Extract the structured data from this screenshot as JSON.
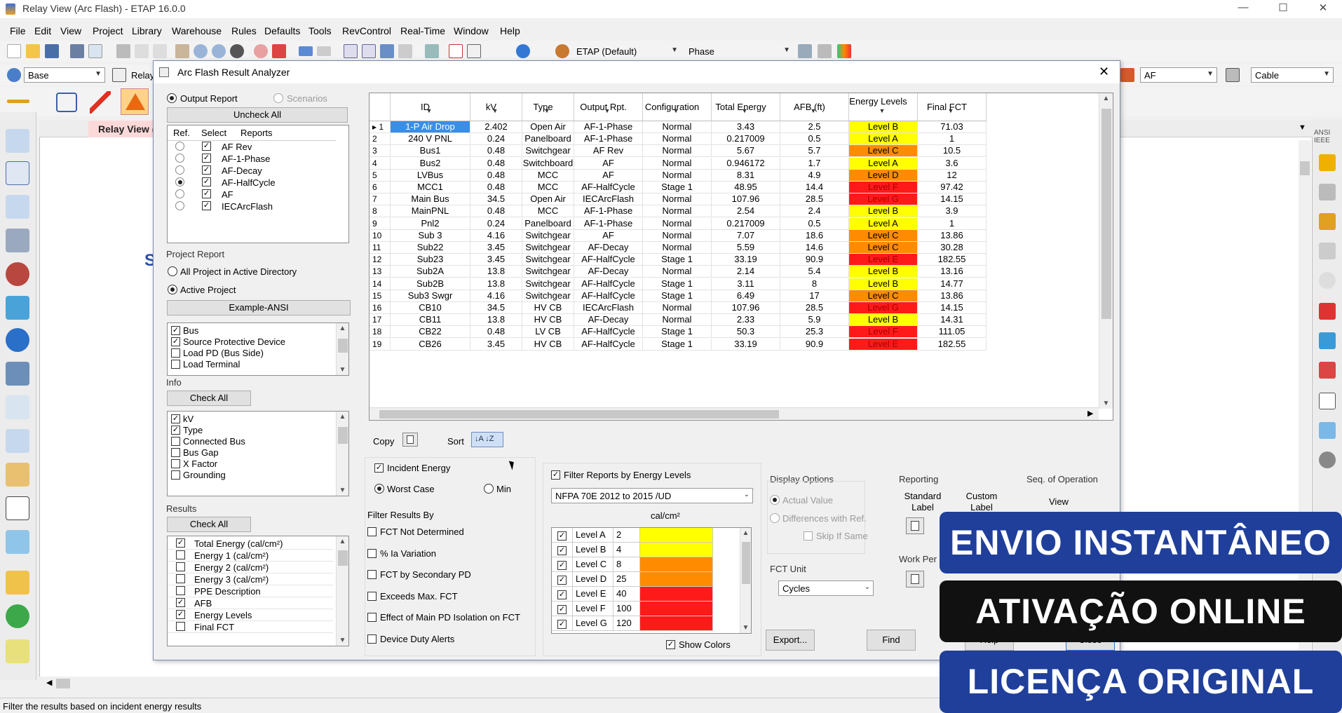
{
  "window": {
    "title": "Relay View (Arc Flash) - ETAP 16.0.0",
    "minimize": "—",
    "maximize": "☐",
    "close": "✕"
  },
  "menu": [
    "File",
    "Edit",
    "View",
    "Project",
    "Library",
    "Warehouse",
    "Rules",
    "Defaults",
    "Tools",
    "RevControl",
    "Real-Time",
    "Window",
    "Help"
  ],
  "toolbar": {
    "preset_select": "ETAP (Default)",
    "phase_select": "Phase",
    "base_select": "Base",
    "relay_label": "Relay",
    "af_select": "AF",
    "cable_select": "Cable"
  },
  "view_tab": "Relay View (Arc Fl",
  "canvas_text": "S",
  "dialog": {
    "title": "Arc Flash Result Analyzer",
    "close": "✕",
    "reports": {
      "output_report": "Output Report",
      "scenarios": "Scenarios",
      "uncheck_all": "Uncheck All",
      "headers": [
        "Ref.",
        "Select",
        "Reports"
      ],
      "rows": [
        {
          "name": "AF Rev",
          "ref": false,
          "selected": true
        },
        {
          "name": "AF-1-Phase",
          "ref": false,
          "selected": true
        },
        {
          "name": "AF-Decay",
          "ref": false,
          "selected": true
        },
        {
          "name": "AF-HalfCycle",
          "ref": true,
          "selected": true
        },
        {
          "name": "AF",
          "ref": false,
          "selected": true
        },
        {
          "name": "IECArcFlash",
          "ref": false,
          "selected": true
        }
      ]
    },
    "project_report": {
      "label": "Project Report",
      "all_project": "All Project in Active Directory",
      "active_project": "Active Project",
      "project_name": "Example-ANSI"
    },
    "device_list": [
      {
        "label": "Bus",
        "checked": true
      },
      {
        "label": "Source Protective Device",
        "checked": true
      },
      {
        "label": "Load PD (Bus Side)",
        "checked": false
      },
      {
        "label": "Load Terminal",
        "checked": false
      }
    ],
    "info": {
      "label": "Info",
      "check_all": "Check All",
      "items": [
        {
          "label": "kV",
          "checked": true
        },
        {
          "label": "Type",
          "checked": true
        },
        {
          "label": "Connected Bus",
          "checked": false
        },
        {
          "label": "Bus Gap",
          "checked": false
        },
        {
          "label": "X Factor",
          "checked": false
        },
        {
          "label": "Grounding",
          "checked": false
        }
      ]
    },
    "results": {
      "label": "Results",
      "check_all": "Check All",
      "items": [
        {
          "label": "Total Energy (cal/cm²)",
          "checked": true
        },
        {
          "label": "Energy 1 (cal/cm²)",
          "checked": false
        },
        {
          "label": "Energy 2 (cal/cm²)",
          "checked": false
        },
        {
          "label": "Energy 3 (cal/cm²)",
          "checked": false
        },
        {
          "label": "PPE Description",
          "checked": false
        },
        {
          "label": "AFB",
          "checked": true
        },
        {
          "label": "Energy Levels",
          "checked": true
        },
        {
          "label": "Final FCT",
          "checked": false
        }
      ]
    },
    "grid": {
      "columns": [
        "ID",
        "kV",
        "Type",
        "Output Rpt.",
        "Configuration",
        "Total Energy",
        "AFB (ft)",
        "Energy Levels",
        "Final FCT"
      ],
      "rows": [
        [
          "1-P Air Drop",
          "2.402",
          "Open Air",
          "AF-1-Phase",
          "Normal",
          "3.43",
          "2.5",
          "Level B",
          "71.03"
        ],
        [
          "240 V PNL",
          "0.24",
          "Panelboard",
          "AF-1-Phase",
          "Normal",
          "0.217009",
          "0.5",
          "Level A",
          "1"
        ],
        [
          "Bus1",
          "0.48",
          "Switchgear",
          "AF Rev",
          "Normal",
          "5.67",
          "5.7",
          "Level C",
          "10.5"
        ],
        [
          "Bus2",
          "0.48",
          "Switchboard",
          "AF",
          "Normal",
          "0.946172",
          "1.7",
          "Level A",
          "3.6"
        ],
        [
          "LVBus",
          "0.48",
          "MCC",
          "AF",
          "Normal",
          "8.31",
          "4.9",
          "Level D",
          "12"
        ],
        [
          "MCC1",
          "0.48",
          "MCC",
          "AF-HalfCycle",
          "Stage 1",
          "48.95",
          "14.4",
          "Level F",
          "97.42"
        ],
        [
          "Main Bus",
          "34.5",
          "Open Air",
          "IECArcFlash",
          "Normal",
          "107.96",
          "28.5",
          "Level G",
          "14.15"
        ],
        [
          "MainPNL",
          "0.48",
          "MCC",
          "AF-1-Phase",
          "Normal",
          "2.54",
          "2.4",
          "Level B",
          "3.9"
        ],
        [
          "Pnl2",
          "0.24",
          "Panelboard",
          "AF-1-Phase",
          "Normal",
          "0.217009",
          "0.5",
          "Level A",
          "1"
        ],
        [
          "Sub 3",
          "4.16",
          "Switchgear",
          "AF",
          "Normal",
          "7.07",
          "18.6",
          "Level C",
          "13.86"
        ],
        [
          "Sub22",
          "3.45",
          "Switchgear",
          "AF-Decay",
          "Normal",
          "5.59",
          "14.6",
          "Level C",
          "30.28"
        ],
        [
          "Sub23",
          "3.45",
          "Switchgear",
          "AF-HalfCycle",
          "Stage 1",
          "33.19",
          "90.9",
          "Level E",
          "182.55"
        ],
        [
          "Sub2A",
          "13.8",
          "Switchgear",
          "AF-Decay",
          "Normal",
          "2.14",
          "5.4",
          "Level B",
          "13.16"
        ],
        [
          "Sub2B",
          "13.8",
          "Switchgear",
          "AF-HalfCycle",
          "Stage 1",
          "3.11",
          "8",
          "Level B",
          "14.77"
        ],
        [
          "Sub3 Swgr",
          "4.16",
          "Switchgear",
          "AF-HalfCycle",
          "Stage 1",
          "6.49",
          "17",
          "Level C",
          "13.86"
        ],
        [
          "CB10",
          "34.5",
          "HV CB",
          "IECArcFlash",
          "Normal",
          "107.96",
          "28.5",
          "Level G",
          "14.15"
        ],
        [
          "CB11",
          "13.8",
          "HV CB",
          "AF-Decay",
          "Normal",
          "2.33",
          "5.9",
          "Level B",
          "14.31"
        ],
        [
          "CB22",
          "0.48",
          "LV CB",
          "AF-HalfCycle",
          "Stage 1",
          "50.3",
          "25.3",
          "Level F",
          "111.05"
        ],
        [
          "CB26",
          "3.45",
          "HV CB",
          "AF-HalfCycle",
          "Stage 1",
          "33.19",
          "90.9",
          "Level E",
          "182.55"
        ]
      ]
    },
    "level_colors": {
      "Level A": "#ffff00",
      "Level B": "#ffff00",
      "Level C": "#ff8c00",
      "Level D": "#ff8c00",
      "Level E": "#ff1a1a",
      "Level F": "#ff1a1a",
      "Level G": "#ff1a1a"
    },
    "copy_label": "Copy",
    "sort_label": "Sort",
    "incident": {
      "incident_energy": "Incident Energy",
      "worst_case": "Worst Case",
      "min": "Min"
    },
    "filter": {
      "label": "Filter Results By",
      "items": [
        "FCT Not Determined",
        "% Ia Variation",
        "FCT by Secondary PD",
        "Exceeds Max. FCT",
        "Effect of Main PD Isolation on FCT",
        "Device Duty Alerts"
      ]
    },
    "energy_filter": {
      "label": "Filter Reports by Energy Levels",
      "standard": "NFPA 70E 2012 to 2015 /UD",
      "unit": "cal/cm²",
      "levels": [
        {
          "name": "Level A",
          "value": "2"
        },
        {
          "name": "Level B",
          "value": "4"
        },
        {
          "name": "Level C",
          "value": "8"
        },
        {
          "name": "Level D",
          "value": "25"
        },
        {
          "name": "Level E",
          "value": "40"
        },
        {
          "name": "Level F",
          "value": "100"
        },
        {
          "name": "Level G",
          "value": "120"
        }
      ],
      "show_colors": "Show Colors"
    },
    "display_options": {
      "label": "Display Options",
      "actual_value": "Actual Value",
      "differences": "Differences with Ref.",
      "skip_same": "Skip If Same"
    },
    "fct_unit": {
      "label": "FCT Unit",
      "value": "Cycles"
    },
    "reporting": {
      "label": "Reporting",
      "standard_label": "Standard Label",
      "custom_label": "Custom Label",
      "work_permit": "Work Per"
    },
    "seq": {
      "label": "Seq. of Operation",
      "view": "View"
    },
    "buttons": {
      "export": "Export...",
      "find": "Find",
      "help": "Help",
      "close": "Close"
    }
  },
  "banners": [
    "ENVIO INSTANTÂNEO",
    "ATIVAÇÃO ONLINE",
    "LICENÇA ORIGINAL"
  ],
  "status_text": "Filter the results based on incident energy results"
}
